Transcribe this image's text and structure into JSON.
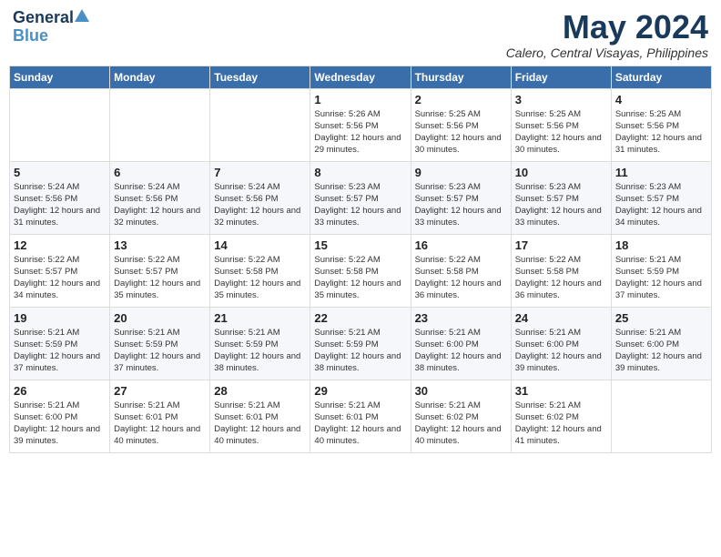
{
  "logo": {
    "line1": "General",
    "line2": "Blue"
  },
  "title": "May 2024",
  "location": "Calero, Central Visayas, Philippines",
  "days_of_week": [
    "Sunday",
    "Monday",
    "Tuesday",
    "Wednesday",
    "Thursday",
    "Friday",
    "Saturday"
  ],
  "weeks": [
    [
      {
        "day": "",
        "info": ""
      },
      {
        "day": "",
        "info": ""
      },
      {
        "day": "",
        "info": ""
      },
      {
        "day": "1",
        "info": "Sunrise: 5:26 AM\nSunset: 5:56 PM\nDaylight: 12 hours\nand 29 minutes."
      },
      {
        "day": "2",
        "info": "Sunrise: 5:25 AM\nSunset: 5:56 PM\nDaylight: 12 hours\nand 30 minutes."
      },
      {
        "day": "3",
        "info": "Sunrise: 5:25 AM\nSunset: 5:56 PM\nDaylight: 12 hours\nand 30 minutes."
      },
      {
        "day": "4",
        "info": "Sunrise: 5:25 AM\nSunset: 5:56 PM\nDaylight: 12 hours\nand 31 minutes."
      }
    ],
    [
      {
        "day": "5",
        "info": "Sunrise: 5:24 AM\nSunset: 5:56 PM\nDaylight: 12 hours\nand 31 minutes."
      },
      {
        "day": "6",
        "info": "Sunrise: 5:24 AM\nSunset: 5:56 PM\nDaylight: 12 hours\nand 32 minutes."
      },
      {
        "day": "7",
        "info": "Sunrise: 5:24 AM\nSunset: 5:56 PM\nDaylight: 12 hours\nand 32 minutes."
      },
      {
        "day": "8",
        "info": "Sunrise: 5:23 AM\nSunset: 5:57 PM\nDaylight: 12 hours\nand 33 minutes."
      },
      {
        "day": "9",
        "info": "Sunrise: 5:23 AM\nSunset: 5:57 PM\nDaylight: 12 hours\nand 33 minutes."
      },
      {
        "day": "10",
        "info": "Sunrise: 5:23 AM\nSunset: 5:57 PM\nDaylight: 12 hours\nand 33 minutes."
      },
      {
        "day": "11",
        "info": "Sunrise: 5:23 AM\nSunset: 5:57 PM\nDaylight: 12 hours\nand 34 minutes."
      }
    ],
    [
      {
        "day": "12",
        "info": "Sunrise: 5:22 AM\nSunset: 5:57 PM\nDaylight: 12 hours\nand 34 minutes."
      },
      {
        "day": "13",
        "info": "Sunrise: 5:22 AM\nSunset: 5:57 PM\nDaylight: 12 hours\nand 35 minutes."
      },
      {
        "day": "14",
        "info": "Sunrise: 5:22 AM\nSunset: 5:58 PM\nDaylight: 12 hours\nand 35 minutes."
      },
      {
        "day": "15",
        "info": "Sunrise: 5:22 AM\nSunset: 5:58 PM\nDaylight: 12 hours\nand 35 minutes."
      },
      {
        "day": "16",
        "info": "Sunrise: 5:22 AM\nSunset: 5:58 PM\nDaylight: 12 hours\nand 36 minutes."
      },
      {
        "day": "17",
        "info": "Sunrise: 5:22 AM\nSunset: 5:58 PM\nDaylight: 12 hours\nand 36 minutes."
      },
      {
        "day": "18",
        "info": "Sunrise: 5:21 AM\nSunset: 5:59 PM\nDaylight: 12 hours\nand 37 minutes."
      }
    ],
    [
      {
        "day": "19",
        "info": "Sunrise: 5:21 AM\nSunset: 5:59 PM\nDaylight: 12 hours\nand 37 minutes."
      },
      {
        "day": "20",
        "info": "Sunrise: 5:21 AM\nSunset: 5:59 PM\nDaylight: 12 hours\nand 37 minutes."
      },
      {
        "day": "21",
        "info": "Sunrise: 5:21 AM\nSunset: 5:59 PM\nDaylight: 12 hours\nand 38 minutes."
      },
      {
        "day": "22",
        "info": "Sunrise: 5:21 AM\nSunset: 5:59 PM\nDaylight: 12 hours\nand 38 minutes."
      },
      {
        "day": "23",
        "info": "Sunrise: 5:21 AM\nSunset: 6:00 PM\nDaylight: 12 hours\nand 38 minutes."
      },
      {
        "day": "24",
        "info": "Sunrise: 5:21 AM\nSunset: 6:00 PM\nDaylight: 12 hours\nand 39 minutes."
      },
      {
        "day": "25",
        "info": "Sunrise: 5:21 AM\nSunset: 6:00 PM\nDaylight: 12 hours\nand 39 minutes."
      }
    ],
    [
      {
        "day": "26",
        "info": "Sunrise: 5:21 AM\nSunset: 6:00 PM\nDaylight: 12 hours\nand 39 minutes."
      },
      {
        "day": "27",
        "info": "Sunrise: 5:21 AM\nSunset: 6:01 PM\nDaylight: 12 hours\nand 40 minutes."
      },
      {
        "day": "28",
        "info": "Sunrise: 5:21 AM\nSunset: 6:01 PM\nDaylight: 12 hours\nand 40 minutes."
      },
      {
        "day": "29",
        "info": "Sunrise: 5:21 AM\nSunset: 6:01 PM\nDaylight: 12 hours\nand 40 minutes."
      },
      {
        "day": "30",
        "info": "Sunrise: 5:21 AM\nSunset: 6:02 PM\nDaylight: 12 hours\nand 40 minutes."
      },
      {
        "day": "31",
        "info": "Sunrise: 5:21 AM\nSunset: 6:02 PM\nDaylight: 12 hours\nand 41 minutes."
      },
      {
        "day": "",
        "info": ""
      }
    ]
  ]
}
